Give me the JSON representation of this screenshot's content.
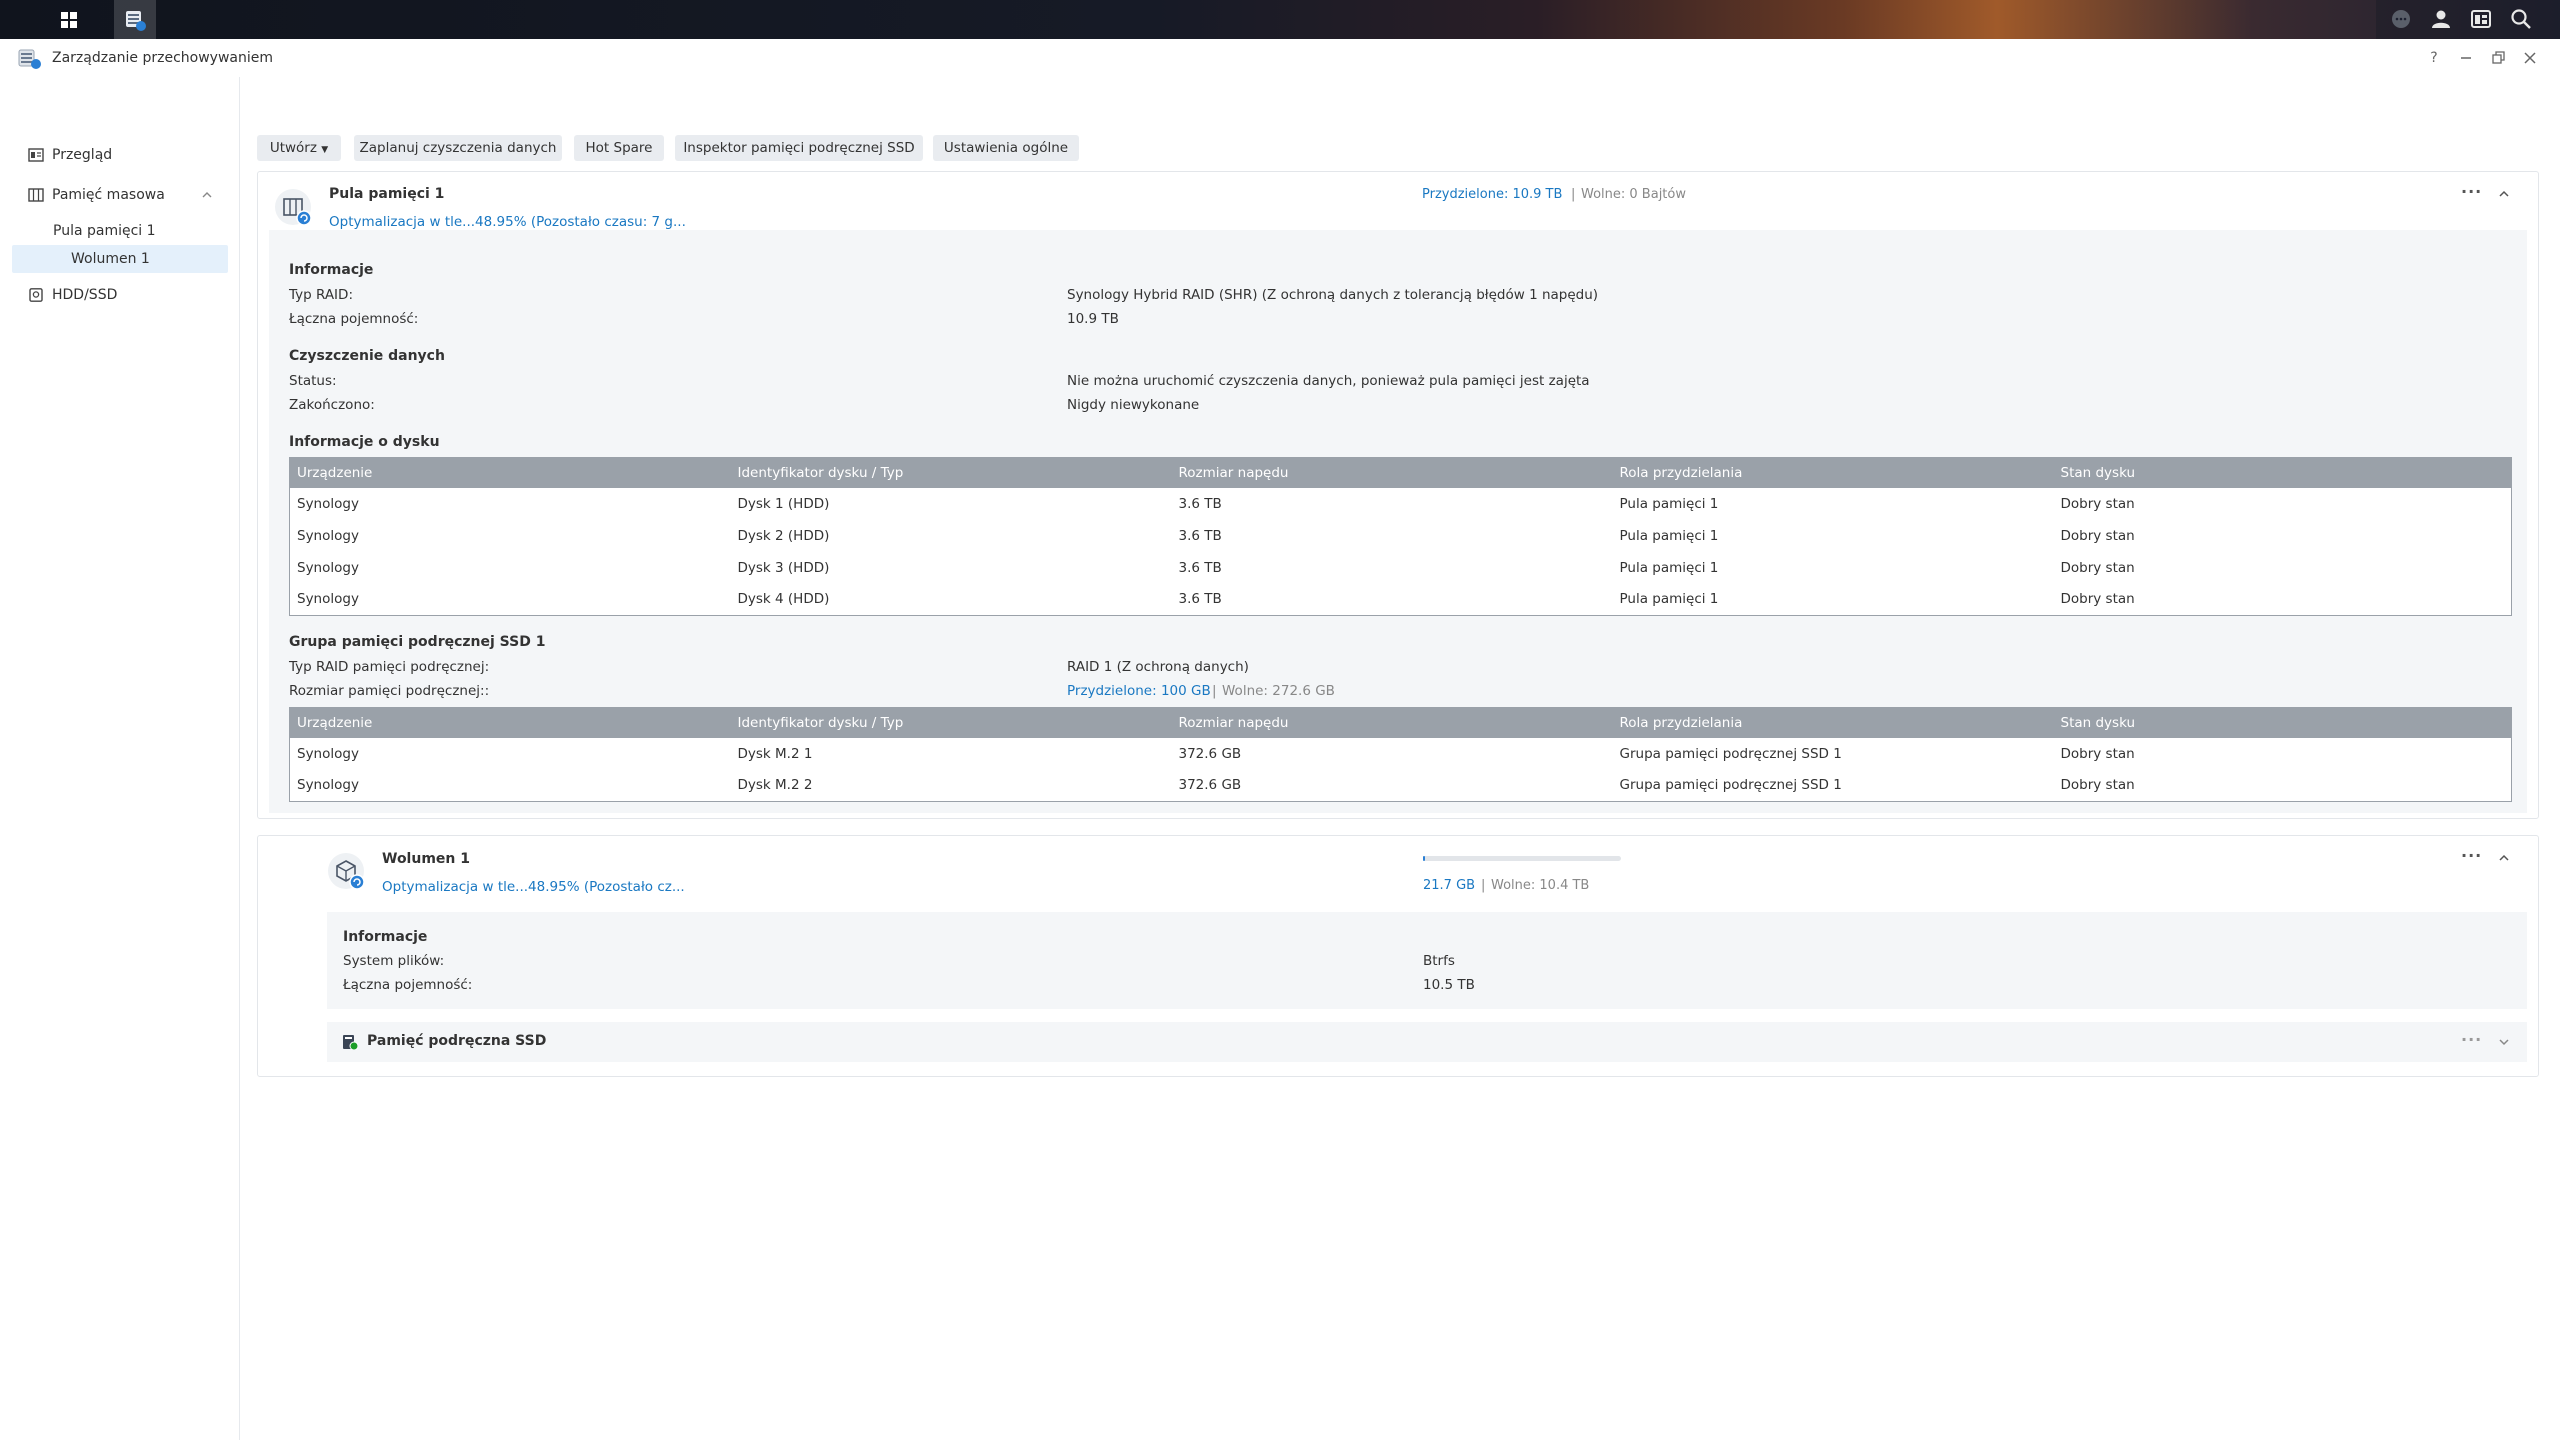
{
  "app": {
    "title": "Zarządzanie przechowywaniem"
  },
  "window_controls": {
    "help": "?"
  },
  "sidebar": {
    "items": [
      {
        "label": "Przegląd"
      },
      {
        "label": "Pamięć masowa"
      },
      {
        "label": "Pula pamięci 1"
      },
      {
        "label": "Wolumen 1"
      },
      {
        "label": "HDD/SSD"
      }
    ]
  },
  "toolbar": {
    "create": "Utwórz",
    "schedule_scrub": "Zaplanuj czyszczenia danych",
    "hot_spare": "Hot Spare",
    "ssd_inspector": "Inspektor pamięci podręcznej SSD",
    "general_settings": "Ustawienia ogólne"
  },
  "pool": {
    "title": "Pula pamięci 1",
    "status": "Optymalizacja w tle...48.95% (Pozostało czasu: 7 g...",
    "allocated": "Przydzielone: 10.9 TB",
    "separator": "|",
    "free": "Wolne: 0 Bajtów",
    "info": {
      "title": "Informacje",
      "raid_type_label": "Typ RAID:",
      "raid_type_value": "Synology Hybrid RAID (SHR) (Z ochroną danych z tolerancją błędów 1 napędu)",
      "capacity_label": "Łączna pojemność:",
      "capacity_value": "10.9 TB"
    },
    "scrub": {
      "title": "Czyszczenie danych",
      "status_label": "Status:",
      "status_value": "Nie można uruchomić czyszczenia danych, ponieważ pula pamięci jest zajęta",
      "finished_label": "Zakończono:",
      "finished_value": "Nigdy niewykonane"
    },
    "disk_info": {
      "title": "Informacje o dysku",
      "headers": [
        "Urządzenie",
        "Identyfikator dysku / Typ",
        "Rozmiar napędu",
        "Rola przydzielania",
        "Stan dysku"
      ],
      "rows": [
        [
          "Synology",
          "Dysk 1 (HDD)",
          "3.6 TB",
          "Pula pamięci 1",
          "Dobry stan"
        ],
        [
          "Synology",
          "Dysk 2 (HDD)",
          "3.6 TB",
          "Pula pamięci 1",
          "Dobry stan"
        ],
        [
          "Synology",
          "Dysk 3 (HDD)",
          "3.6 TB",
          "Pula pamięci 1",
          "Dobry stan"
        ],
        [
          "Synology",
          "Dysk 4 (HDD)",
          "3.6 TB",
          "Pula pamięci 1",
          "Dobry stan"
        ]
      ]
    },
    "ssd_group": {
      "title": "Grupa pamięci podręcznej SSD 1",
      "raid_label": "Typ RAID pamięci podręcznej:",
      "raid_value": "RAID 1 (Z ochroną danych)",
      "size_label": "Rozmiar pamięci podręcznej::",
      "size_allocated": "Przydzielone: 100 GB",
      "size_free": "Wolne: 272.6 GB",
      "headers": [
        "Urządzenie",
        "Identyfikator dysku / Typ",
        "Rozmiar napędu",
        "Rola przydzielania",
        "Stan dysku"
      ],
      "rows": [
        [
          "Synology",
          "Dysk M.2 1",
          "372.6 GB",
          "Grupa pamięci podręcznej SSD 1",
          "Dobry stan"
        ],
        [
          "Synology",
          "Dysk M.2 2",
          "372.6 GB",
          "Grupa pamięci podręcznej SSD 1",
          "Dobry stan"
        ]
      ]
    }
  },
  "volume": {
    "title": "Wolumen 1",
    "status": "Optymalizacja w tle...48.95% (Pozostało cz...",
    "used": "21.7 GB",
    "free": "Wolne: 10.4 TB",
    "usage_fraction": 0.002,
    "info": {
      "title": "Informacje",
      "fs_label": "System plików:",
      "fs_value": "Btrfs",
      "capacity_label": "Łączna pojemność:",
      "capacity_value": "10.5 TB"
    },
    "ssd_cache": {
      "title": "Pamięć podręczna SSD"
    }
  },
  "colors": {
    "accent": "#1a78c2",
    "good": "#1c9e28",
    "table_header": "#9aa1a9"
  }
}
